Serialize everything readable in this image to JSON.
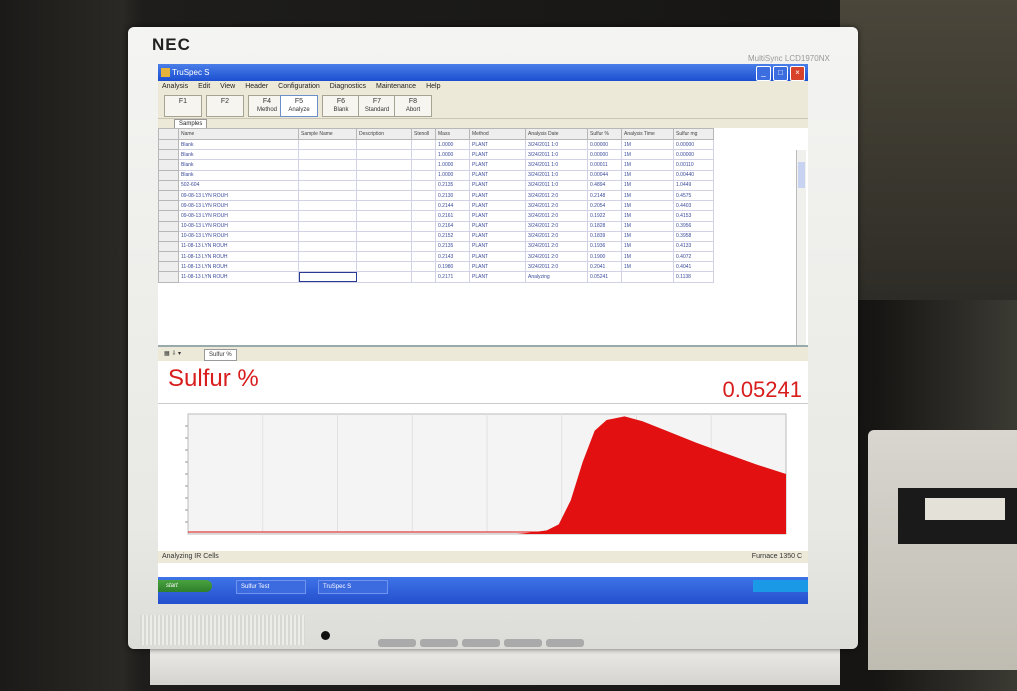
{
  "monitor": {
    "brand": "NEC",
    "model": "MultiSync LCD1970NX"
  },
  "window": {
    "title": "TruSpec S"
  },
  "menu": [
    "Analysis",
    "Edit",
    "View",
    "Header",
    "Configuration",
    "Diagnostics",
    "Maintenance",
    "Help"
  ],
  "toolbar": [
    {
      "key": "F1",
      "label": ""
    },
    {
      "key": "F2",
      "label": ""
    },
    {
      "key": "F4",
      "label": "Method"
    },
    {
      "key": "F5",
      "label": "Analyze"
    },
    {
      "key": "F6",
      "label": "Blank"
    },
    {
      "key": "F7",
      "label": "Standard"
    },
    {
      "key": "F8",
      "label": "Abort"
    }
  ],
  "tab_label": "Samples",
  "table": {
    "columns": [
      "Name",
      "Sample Name",
      "Description",
      "Stenoll",
      "Mass",
      "Method",
      "Analysis Date",
      "Sulfur %",
      "Analysis Time",
      "Sulfur mg"
    ],
    "rows": [
      [
        "Blank",
        "",
        "",
        "",
        "1.0000",
        "PLANT",
        "3/24/2011 1:0",
        "0.00000",
        "1M",
        "0.00000"
      ],
      [
        "Blank",
        "",
        "",
        "",
        "1.0000",
        "PLANT",
        "3/24/2011 1:0",
        "0.00000",
        "1M",
        "0.00000"
      ],
      [
        "Blank",
        "",
        "",
        "",
        "1.0000",
        "PLANT",
        "3/24/2011 1:0",
        "0.00011",
        "1M",
        "0.00110"
      ],
      [
        "Blank",
        "",
        "",
        "",
        "1.0000",
        "PLANT",
        "3/24/2011 1:0",
        "0.00044",
        "1M",
        "0.00440"
      ],
      [
        "502-604",
        "",
        "",
        "",
        "0.2135",
        "PLANT",
        "3/24/2011 1:0",
        "0.4894",
        "1M",
        "1.0449"
      ],
      [
        "09-08-13 LYN ROUH",
        "",
        "",
        "",
        "0.2130",
        "PLANT",
        "3/24/2011 2:0",
        "0.2148",
        "1M",
        "0.4575"
      ],
      [
        "09-08-13 LYN ROUH",
        "",
        "",
        "",
        "0.2144",
        "PLANT",
        "3/24/2011 2:0",
        "0.2054",
        "1M",
        "0.4403"
      ],
      [
        "09-08-13 LYN ROUH",
        "",
        "",
        "",
        "0.2161",
        "PLANT",
        "3/24/2011 2:0",
        "0.1922",
        "1M",
        "0.4153"
      ],
      [
        "10-08-13 LYN ROUH",
        "",
        "",
        "",
        "0.2164",
        "PLANT",
        "3/24/2011 2:0",
        "0.1828",
        "1M",
        "0.3956"
      ],
      [
        "10-08-13 LYN ROUH",
        "",
        "",
        "",
        "0.2152",
        "PLANT",
        "3/24/2011 2:0",
        "0.1839",
        "1M",
        "0.3958"
      ],
      [
        "11-08-13 LYN ROUH",
        "",
        "",
        "",
        "0.2135",
        "PLANT",
        "3/24/2011 2:0",
        "0.1936",
        "1M",
        "0.4133"
      ],
      [
        "11-08-13 LYN ROUH",
        "",
        "",
        "",
        "0.2143",
        "PLANT",
        "3/24/2011 2:0",
        "0.1900",
        "1M",
        "0.4072"
      ],
      [
        "11-08-13 LYN ROUH",
        "",
        "",
        "",
        "0.1980",
        "PLANT",
        "3/24/2011 2:0",
        "0.2041",
        "1M",
        "0.4041"
      ],
      [
        "11-08-13 LYN ROUH",
        "",
        "",
        "",
        "0.2171",
        "PLANT",
        "Analyzing",
        "0.05241",
        "",
        "0.1138"
      ]
    ],
    "selected_row": 13
  },
  "panel": {
    "tab_label": "Sulfur %",
    "result_label": "Sulfur %",
    "result_value": "0.05241"
  },
  "chart_data": {
    "type": "area",
    "series": [
      {
        "color": "#e21010",
        "x": [
          0,
          20,
          40,
          50,
          55,
          57,
          60,
          62,
          64,
          66,
          68,
          70,
          73,
          76,
          80,
          85,
          90,
          95,
          100
        ],
        "values": [
          0,
          0,
          0,
          0,
          0,
          1,
          3,
          8,
          28,
          60,
          86,
          95,
          98,
          94,
          86,
          76,
          67,
          58,
          50
        ]
      }
    ],
    "xlim": [
      0,
      100
    ],
    "ylim": [
      0,
      100
    ],
    "xlabel": "",
    "ylabel": "",
    "grid": true
  },
  "status": {
    "left": "Analyzing IR Cells",
    "right": "Furnace 1350 C"
  },
  "taskbar": {
    "start": "start",
    "items": [
      "Sulfur Test",
      "TruSpec S"
    ],
    "clock": ""
  }
}
